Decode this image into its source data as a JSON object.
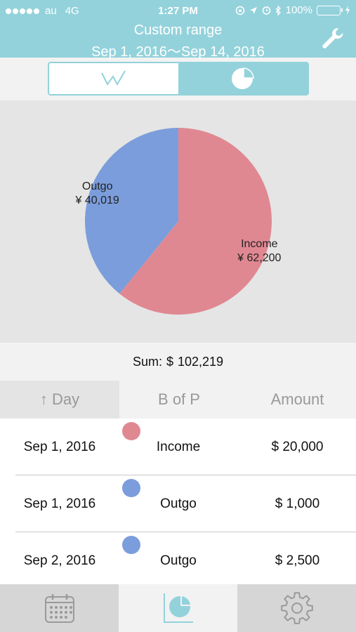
{
  "status_bar": {
    "carrier": "au",
    "network": "4G",
    "time": "1:27 PM",
    "battery": "100%"
  },
  "header": {
    "title": "Custom range",
    "subtitle": "Sep 1, 2016〜Sep 14, 2016",
    "settings_icon": "wrench-icon",
    "color": "#93d2db"
  },
  "view_toggle": {
    "options": [
      {
        "icon": "line-chart-icon",
        "selected": false
      },
      {
        "icon": "pie-chart-icon",
        "selected": true
      }
    ]
  },
  "chart_data": {
    "type": "pie",
    "slices": [
      {
        "name": "Income",
        "value": 62200,
        "label": "¥ 62,200",
        "color": "#e08892"
      },
      {
        "name": "Outgo",
        "value": 40019,
        "label": "¥ 40,019",
        "color": "#7b9ddc"
      }
    ]
  },
  "sum": {
    "label": "Sum:",
    "currency": "$",
    "value": "102,219"
  },
  "table": {
    "headers": {
      "day": "↑ Day",
      "bop": "B of P",
      "amount": "Amount"
    },
    "rows": [
      {
        "date": "Sep 1, 2016",
        "type": "Income",
        "amount": "$  20,000",
        "color": "#e08892"
      },
      {
        "date": "Sep 1, 2016",
        "type": "Outgo",
        "amount": "$  1,000",
        "color": "#7b9ddc"
      },
      {
        "date": "Sep 2, 2016",
        "type": "Outgo",
        "amount": "$  2,500",
        "color": "#7b9ddc"
      }
    ]
  },
  "tabbar": {
    "tabs": [
      {
        "icon": "calendar-icon",
        "active": false
      },
      {
        "icon": "chart-icon",
        "active": true
      },
      {
        "icon": "gear-icon",
        "active": false
      }
    ]
  }
}
